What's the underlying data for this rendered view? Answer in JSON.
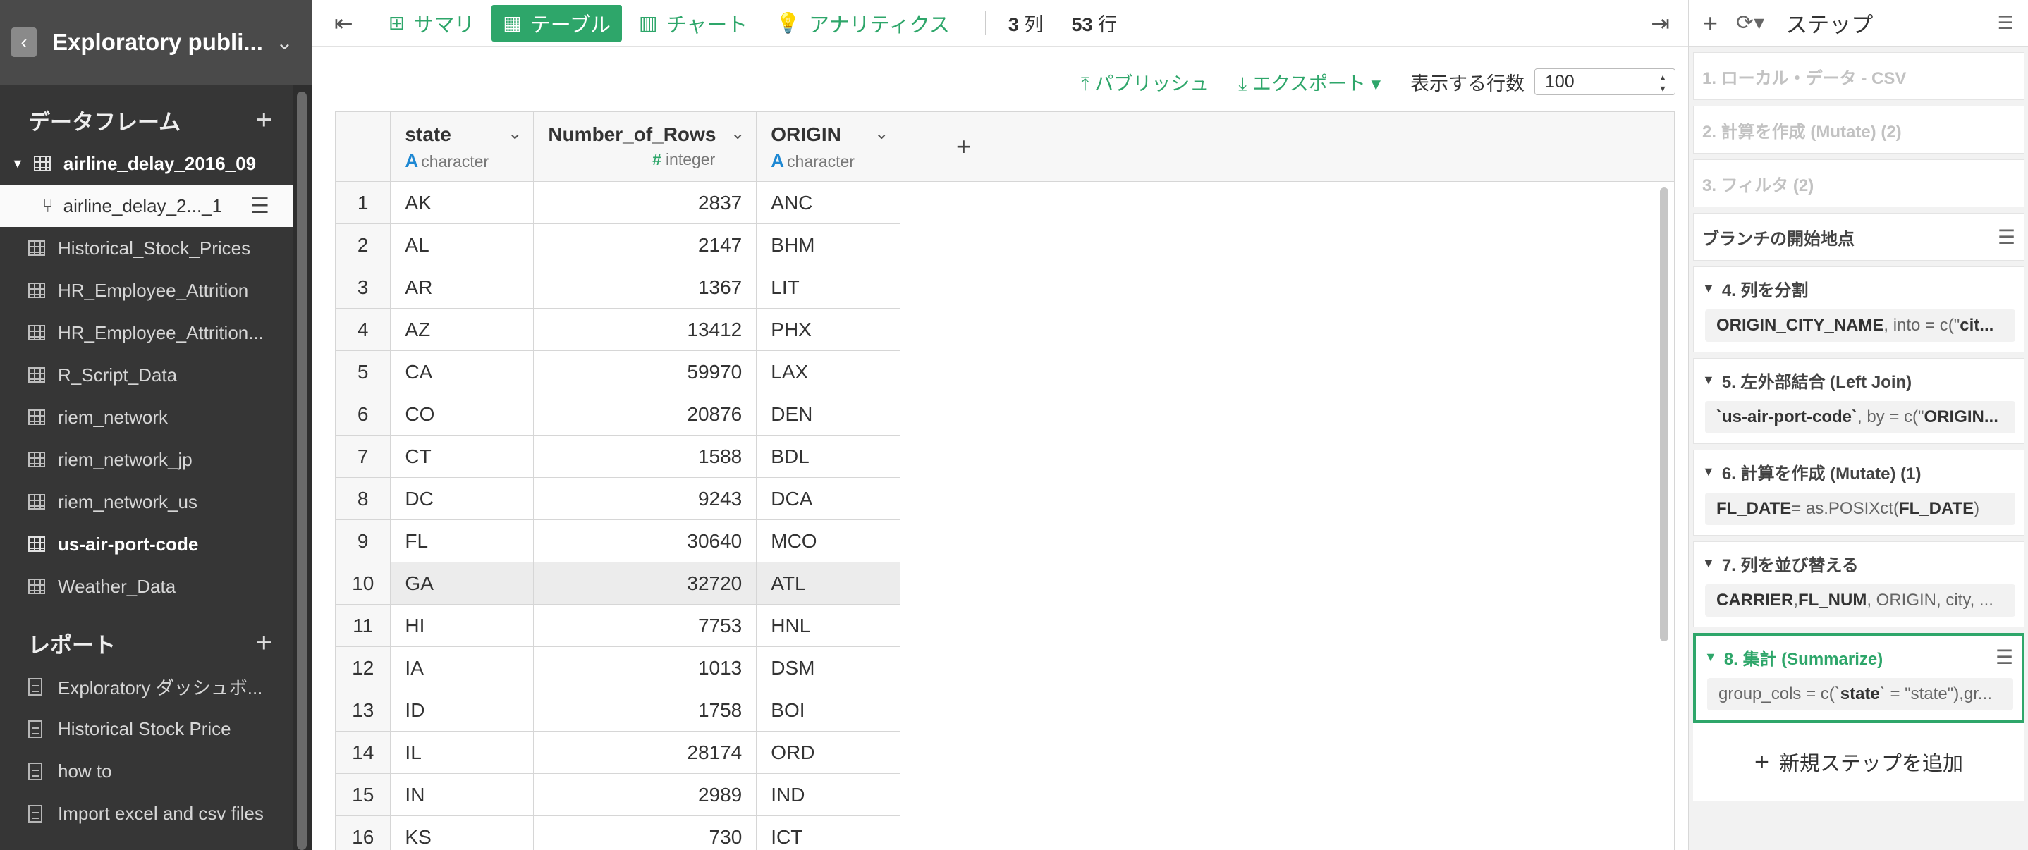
{
  "project": {
    "title": "Exploratory publi...",
    "back_icon": "chevron-left-icon"
  },
  "sidebar": {
    "dataframes_title": "データフレーム",
    "dataframes": [
      {
        "label": "airline_delay_2016_09",
        "type": "top"
      },
      {
        "label": "airline_delay_2..._1",
        "type": "branch"
      },
      {
        "label": "Historical_Stock_Prices",
        "type": "normal"
      },
      {
        "label": "HR_Employee_Attrition",
        "type": "normal"
      },
      {
        "label": "HR_Employee_Attrition...",
        "type": "normal"
      },
      {
        "label": "R_Script_Data",
        "type": "normal"
      },
      {
        "label": "riem_network",
        "type": "normal"
      },
      {
        "label": "riem_network_jp",
        "type": "normal"
      },
      {
        "label": "riem_network_us",
        "type": "normal"
      },
      {
        "label": "us-air-port-code",
        "type": "bold"
      },
      {
        "label": "Weather_Data",
        "type": "normal"
      }
    ],
    "reports_title": "レポート",
    "reports": [
      {
        "label": "Exploratory ダッシュボ..."
      },
      {
        "label": "Historical Stock Price"
      },
      {
        "label": "how to"
      },
      {
        "label": "Import excel and csv files"
      }
    ]
  },
  "toolbar": {
    "tabs": [
      {
        "label": "サマリ",
        "icon": "summary-grid-icon",
        "active": false
      },
      {
        "label": "テーブル",
        "icon": "table-icon",
        "active": true
      },
      {
        "label": "チャート",
        "icon": "bar-chart-icon",
        "active": false
      },
      {
        "label": "アナリティクス",
        "icon": "lightbulb-icon",
        "active": false
      }
    ],
    "col_count": "3",
    "col_unit": "列",
    "row_count": "53",
    "row_unit": "行"
  },
  "subbar": {
    "publish": "パブリッシュ",
    "export": "エクスポート",
    "rows_label": "表示する行数",
    "rows_value": "100"
  },
  "table": {
    "columns": [
      {
        "name": "state",
        "type": "character"
      },
      {
        "name": "Number_of_Rows",
        "type": "integer"
      },
      {
        "name": "ORIGIN",
        "type": "character"
      }
    ],
    "add_column": "+",
    "rows": [
      [
        "1",
        "AK",
        "2837",
        "ANC"
      ],
      [
        "2",
        "AL",
        "2147",
        "BHM"
      ],
      [
        "3",
        "AR",
        "1367",
        "LIT"
      ],
      [
        "4",
        "AZ",
        "13412",
        "PHX"
      ],
      [
        "5",
        "CA",
        "59970",
        "LAX"
      ],
      [
        "6",
        "CO",
        "20876",
        "DEN"
      ],
      [
        "7",
        "CT",
        "1588",
        "BDL"
      ],
      [
        "8",
        "DC",
        "9243",
        "DCA"
      ],
      [
        "9",
        "FL",
        "30640",
        "MCO"
      ],
      [
        "10",
        "GA",
        "32720",
        "ATL"
      ],
      [
        "11",
        "HI",
        "7753",
        "HNL"
      ],
      [
        "12",
        "IA",
        "1013",
        "DSM"
      ],
      [
        "13",
        "ID",
        "1758",
        "BOI"
      ],
      [
        "14",
        "IL",
        "28174",
        "ORD"
      ],
      [
        "15",
        "IN",
        "2989",
        "IND"
      ],
      [
        "16",
        "KS",
        "730",
        "ICT"
      ]
    ],
    "highlight_row": "10"
  },
  "steps": {
    "title": "ステップ",
    "disabled": [
      "1. ローカル・データ - CSV",
      "2. 計算を作成 (Mutate) (2)",
      "3. フィルタ (2)"
    ],
    "branch_start": "ブランチの開始地点",
    "items": [
      {
        "title": "4. 列を分割",
        "b1": "ORIGIN_CITY_NAME",
        "t1": ", into = c(\"",
        "b2": "cit...",
        "t2": ""
      },
      {
        "title": "5. 左外部結合 (Left Join)",
        "b1": "`us-air-port-code`",
        "t1": ", by = c(\"",
        "b2": "ORIGIN...",
        "t2": ""
      },
      {
        "title": "6. 計算を作成 (Mutate) (1)",
        "b1": "FL_DATE",
        "t1": " = as.POSIXct(",
        "b2": "FL_DATE",
        "t2": ")"
      },
      {
        "title": "7. 列を並び替える",
        "b1": "CARRIER",
        "t1": ", ",
        "b2": "FL_NUM",
        "t2": ", ORIGIN, city, ..."
      },
      {
        "title": "8. 集計 (Summarize)",
        "b1": "",
        "t1": "group_cols = c(`",
        "b2": "state",
        "t2": "` = \"state\"),gr..."
      }
    ],
    "add_step": "新規ステップを追加",
    "accent_color": "#2ea66a"
  }
}
